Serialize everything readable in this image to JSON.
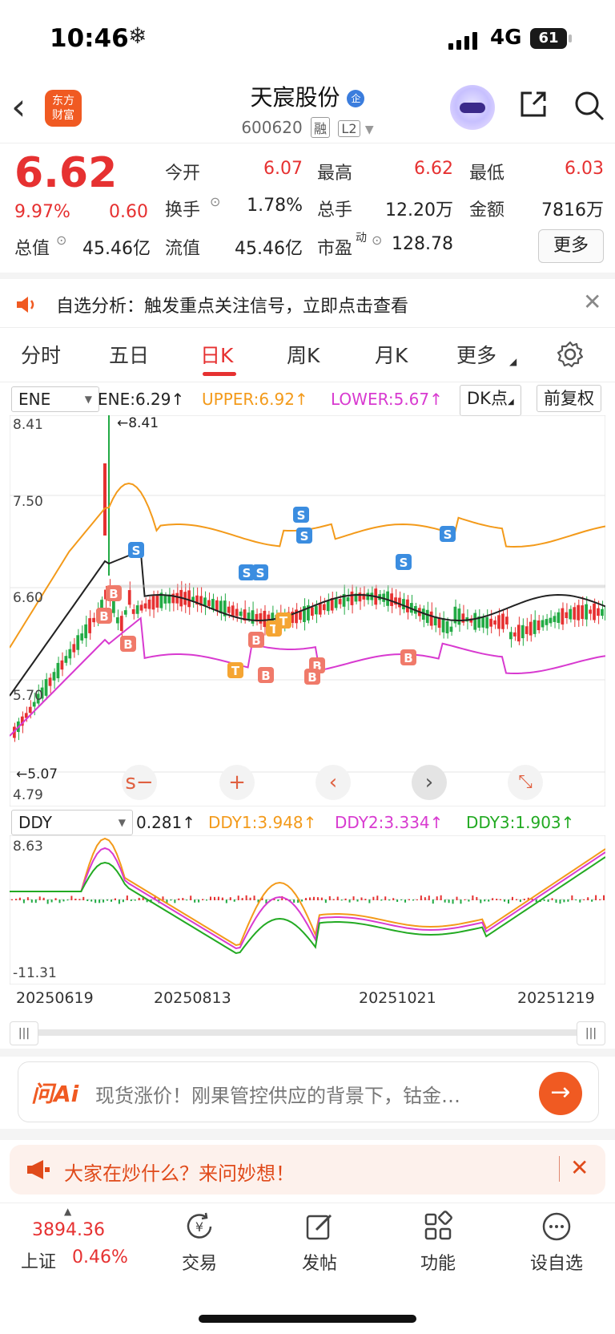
{
  "status_bar": {
    "time": "10:46",
    "network": "4G",
    "battery": "61"
  },
  "header": {
    "title": "天宸股份",
    "code": "600620",
    "tag_margin": "融",
    "tag_level": "L2",
    "logo_text_line1": "东方",
    "logo_text_line2": "财富"
  },
  "quote": {
    "price": "6.62",
    "change_pct": "9.97%",
    "change": "0.60",
    "open_label": "今开",
    "open": "6.07",
    "high_label": "最高",
    "high": "6.62",
    "low_label": "最低",
    "low": "6.03",
    "turnover_label": "换手",
    "turnover": "1.78%",
    "volume_label": "总手",
    "volume": "12.20万",
    "amount_label": "金额",
    "amount": "7816万",
    "mktcap_label": "总值",
    "mktcap": "45.46亿",
    "float_label": "流值",
    "float_cap": "45.46亿",
    "pe_label": "市盈",
    "pe_sup": "动",
    "pe": "128.78",
    "more_button": "更多"
  },
  "notice": {
    "text": "自选分析：触发重点关注信号，立即点击查看"
  },
  "tabs": [
    "分时",
    "五日",
    "日K",
    "周K",
    "月K",
    "更多"
  ],
  "active_tab": "日K",
  "main_indicator": {
    "select": "ENE",
    "ene": "ENE:6.29↑",
    "upper": "UPPER:6.92↑",
    "lower": "LOWER:5.67↑",
    "dk_button": "DK点",
    "adjust_button": "前复权",
    "max_mark": "←8.41",
    "min_mark": "←5.07",
    "y_ticks": [
      "8.41",
      "7.50",
      "6.60",
      "5.70",
      "4.79"
    ]
  },
  "sub_indicator": {
    "select": "DDY",
    "ddy": "0.281↑",
    "ddy1": "DDY1:3.948↑",
    "ddy2": "DDY2:3.334↑",
    "ddy3": "DDY3:1.903↑",
    "y_top": "8.63",
    "y_bottom": "-11.31"
  },
  "dates": [
    "20250619",
    "20250813",
    "20251021",
    "20251219"
  ],
  "ai_bar": {
    "logo": "问Ai",
    "text": "现货涨价！刚果管控供应的背景下，钴金…"
  },
  "chat_bar": {
    "text": "大家在炒什么？来问妙想！"
  },
  "bottom_nav": {
    "index_value": "3894.36",
    "index_name": "上证",
    "index_pct": "0.46%",
    "items": [
      "交易",
      "发帖",
      "功能",
      "设自选"
    ]
  },
  "colors": {
    "accent": "#e63131",
    "upper": "#f39a1a",
    "lower": "#d83ad0",
    "ene": "#222222",
    "ddy3": "#22aa22",
    "brand": "#f05a22"
  }
}
